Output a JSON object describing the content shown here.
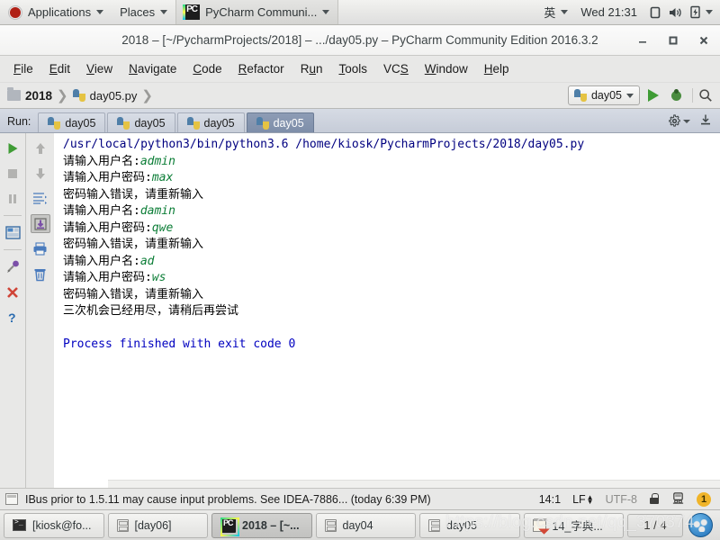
{
  "gnome_panel": {
    "logo_icon": "ubuntu-logo-icon",
    "applications_label": "Applications",
    "places_label": "Places",
    "active_app_label": "PyCharm Communi...",
    "active_app_icon": "pycharm-icon",
    "input_method": "英",
    "clock": "Wed 21:31",
    "tray": [
      {
        "name": "display-icon",
        "glyph": "▢"
      },
      {
        "name": "volume-icon",
        "glyph": "🔊"
      },
      {
        "name": "battery-icon",
        "glyph": "🔋"
      }
    ]
  },
  "window": {
    "title": "2018 – [~/PycharmProjects/2018] – .../day05.py – PyCharm Community Edition 2016.3.2",
    "controls": {
      "minimize": "–",
      "maximize": "❐",
      "close": "✕"
    }
  },
  "menu_bar": {
    "items": [
      {
        "label": "File",
        "mnemonic": "F"
      },
      {
        "label": "Edit",
        "mnemonic": "E"
      },
      {
        "label": "View",
        "mnemonic": "V"
      },
      {
        "label": "Navigate",
        "mnemonic": "N"
      },
      {
        "label": "Code",
        "mnemonic": "C"
      },
      {
        "label": "Refactor",
        "mnemonic": "R"
      },
      {
        "label": "Run",
        "mnemonic": "u"
      },
      {
        "label": "Tools",
        "mnemonic": "T"
      },
      {
        "label": "VCS",
        "mnemonic": "S"
      },
      {
        "label": "Window",
        "mnemonic": "W"
      },
      {
        "label": "Help",
        "mnemonic": "H"
      }
    ]
  },
  "nav_bar": {
    "breadcrumbs": [
      {
        "label": "2018",
        "icon": "folder-icon"
      },
      {
        "label": "day05.py",
        "icon": "python-file-icon"
      }
    ],
    "run_config": {
      "label": "day05",
      "icon": "python-config-icon",
      "dropdown": "▾"
    },
    "run_button": "run-button",
    "debug_button": "debug-button",
    "search_button": "search-everywhere-button"
  },
  "run_tool_window": {
    "title": "Run:",
    "tabs": [
      {
        "label": "day05",
        "selected": false
      },
      {
        "label": "day05",
        "selected": false
      },
      {
        "label": "day05",
        "selected": false
      },
      {
        "label": "day05",
        "selected": true
      }
    ],
    "settings_icon": "gear-icon",
    "hide_icon": "hide-window-icon",
    "left_toolbar": [
      {
        "name": "rerun-button",
        "glyph": "▶"
      },
      {
        "name": "stop-button",
        "glyph": "■"
      },
      {
        "name": "pause-button",
        "glyph": "❚❚"
      },
      {
        "name": "layout-button",
        "glyph": "▥"
      },
      {
        "name": "pin-tab-button",
        "glyph": "📌"
      },
      {
        "name": "close-button",
        "glyph": "✕"
      },
      {
        "name": "help-button",
        "glyph": "?"
      }
    ],
    "right_toolbar": [
      {
        "name": "up-arrow-button",
        "glyph": "↑"
      },
      {
        "name": "down-arrow-button",
        "glyph": "↓"
      },
      {
        "name": "soft-wrap-button",
        "glyph": "⇥"
      },
      {
        "name": "scroll-to-end-button",
        "glyph": "⤓",
        "pressed": true
      },
      {
        "name": "print-button",
        "glyph": "🖶"
      },
      {
        "name": "clear-all-button",
        "glyph": "🗑"
      }
    ]
  },
  "console": {
    "command_line": "/usr/local/python3/bin/python3.6 /home/kiosk/PycharmProjects/2018/day05.py",
    "lines": [
      {
        "prompt": "请输入用户名:",
        "input": "admin"
      },
      {
        "prompt": "请输入用户密码:",
        "input": "max"
      },
      {
        "prompt": "密码输入错误，请重新输入",
        "input": ""
      },
      {
        "prompt": "请输入用户名:",
        "input": "damin"
      },
      {
        "prompt": "请输入用户密码:",
        "input": "qwe"
      },
      {
        "prompt": "密码输入错误，请重新输入",
        "input": ""
      },
      {
        "prompt": "请输入用户名:",
        "input": "ad"
      },
      {
        "prompt": "请输入用户密码:",
        "input": "ws"
      },
      {
        "prompt": "密码输入错误，请重新输入",
        "input": ""
      },
      {
        "prompt": "三次机会已经用尽，请稍后再尝试",
        "input": ""
      }
    ],
    "exit_message": "Process finished with exit code 0"
  },
  "status_bar": {
    "icon": "event-log-icon",
    "message": "IBus prior to 1.5.11 may cause input problems. See IDEA-7886... (today 6:39 PM)",
    "caret_position": "14:1",
    "line_separator": "LF",
    "encoding": "UTF-8",
    "lock_icon": "read-only-lock-icon",
    "train_icon": "background-tasks-icon",
    "notification_count": "1"
  },
  "taskbar": {
    "items": [
      {
        "label": "[kiosk@fo...",
        "icon": "terminal-icon",
        "active": false
      },
      {
        "label": "[day06]",
        "icon": "file-manager-icon",
        "active": false
      },
      {
        "label": "2018 – [~...",
        "icon": "pycharm-icon",
        "active": true
      },
      {
        "label": "day04",
        "icon": "file-manager-icon",
        "active": false
      },
      {
        "label": "day05",
        "icon": "file-manager-icon",
        "active": false
      },
      {
        "label": "14_字典...",
        "icon": "notepad-icon",
        "active": false
      }
    ],
    "workspace_indicator": "1 / 4",
    "globe_icon": "workspace-switcher-icon"
  },
  "watermark": {
    "text": "https://blog.csdn.net/qq_370374"
  }
}
